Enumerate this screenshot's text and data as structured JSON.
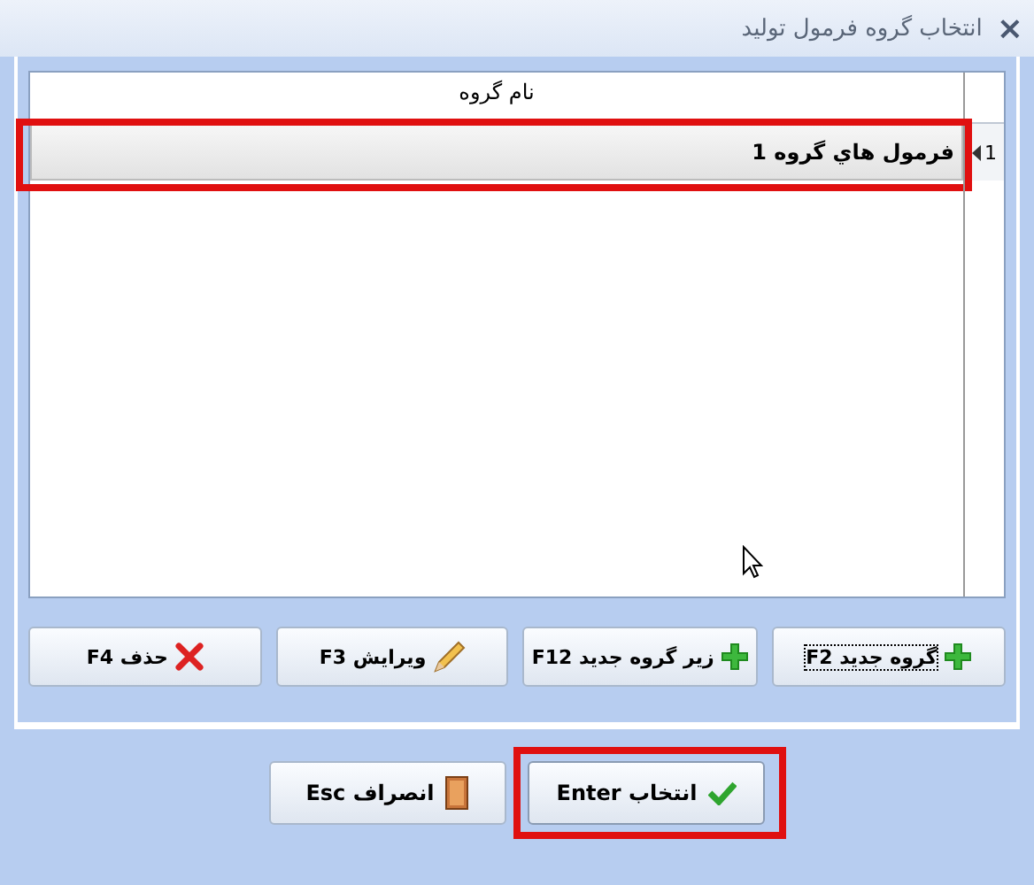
{
  "window": {
    "title": "انتخاب گروه فرمول تولید",
    "close": "×"
  },
  "grid": {
    "columns": [
      "نام گروه"
    ],
    "rows": [
      {
        "index": "1",
        "name": "فرمول هاي گروه 1",
        "selected": true,
        "current": true
      }
    ]
  },
  "actions": [
    {
      "label": "گروه جدید F2",
      "kind": "add",
      "focused": true
    },
    {
      "label": "زیر گروه جدید F12",
      "kind": "add",
      "focused": false
    },
    {
      "label": "ویرایش F3",
      "kind": "edit",
      "focused": false
    },
    {
      "label": "حذف F4",
      "kind": "delete",
      "focused": false
    }
  ],
  "footer": [
    {
      "label": "انتخاب Enter",
      "kind": "ok",
      "highlighted": true
    },
    {
      "label": "انصراف Esc",
      "kind": "cancel",
      "highlighted": false
    }
  ]
}
